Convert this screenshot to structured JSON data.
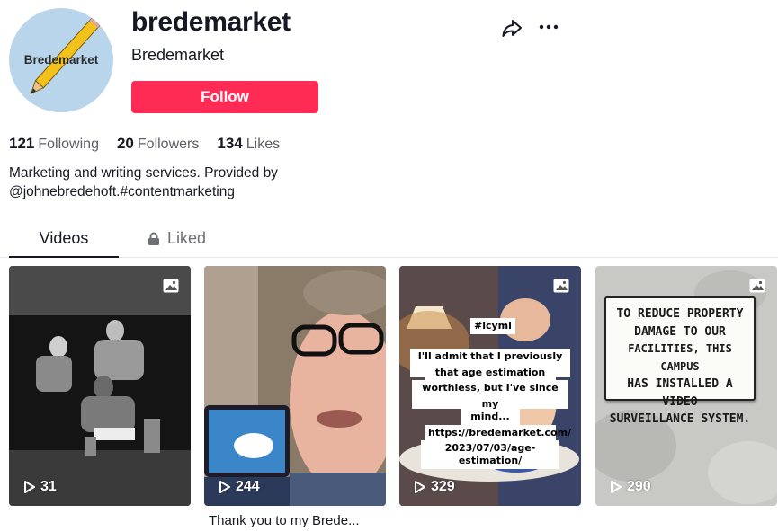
{
  "profile": {
    "avatar_text": "Bredemarket",
    "username": "bredemarket",
    "nickname": "Bredemarket",
    "follow_label": "Follow",
    "icons": [
      "share-icon",
      "more-icon"
    ]
  },
  "stats": {
    "following_count": "121",
    "following_label": "Following",
    "followers_count": "20",
    "followers_label": "Followers",
    "likes_count": "134",
    "likes_label": "Likes"
  },
  "bio": {
    "line1": "Marketing and writing services. Provided by",
    "line2": "@johnebredehoft.#contentmarketing"
  },
  "tabs": {
    "videos": "Videos",
    "liked": "Liked"
  },
  "videos": [
    {
      "views": "31"
    },
    {
      "views": "244",
      "caption": "Thank you to my Brede..."
    },
    {
      "views": "329",
      "overlay_tag": "#icymi",
      "overlay_text_1": "I'll admit that I previously thought",
      "overlay_text_2": "that age estimation was",
      "overlay_text_3": "worthless, but I've since changed",
      "overlay_text_4": "my mind...",
      "overlay_url_1": "https://bredemarket.com/",
      "overlay_url_2": "2023/07/03/age-estimation/"
    },
    {
      "views": "290",
      "sign_lines": [
        "TO REDUCE PROPERTY",
        "DAMAGE TO OUR",
        "FACILITIES, THIS CAMPUS",
        "HAS INSTALLED A VIDEO",
        "SURVEILLANCE SYSTEM."
      ]
    }
  ],
  "colors": {
    "follow_button": "#fe2c55",
    "avatar_bg": "#b9d5ec",
    "text_primary": "#161823",
    "text_secondary": "#5d5f66"
  }
}
